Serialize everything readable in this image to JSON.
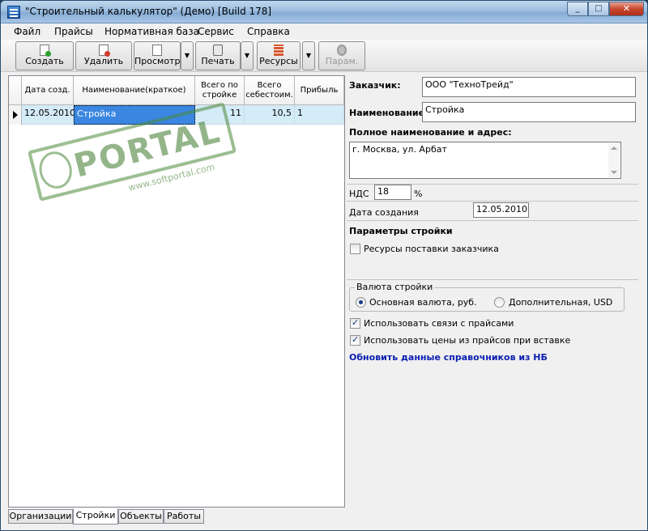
{
  "window": {
    "title": "\"Строительный калькулятор\" (Демо) [Build 178]",
    "minimize": "_",
    "maximize": "□",
    "close": "✕"
  },
  "menu": [
    "Файл",
    "Прайсы",
    "Нормативная база",
    "Сервис",
    "Справка"
  ],
  "toolbar": {
    "create": "Создать",
    "delete": "Удалить",
    "view": "Просмотр",
    "print": "Печать",
    "resources": "Ресурсы",
    "params": "Парам."
  },
  "grid": {
    "headers": [
      "Дата созд.",
      "Наименование(краткое)",
      "Всего по стройке",
      "Всего себестоим.",
      "Прибыль"
    ],
    "rows": [
      {
        "date": "12.05.2010",
        "name": "Стройка",
        "total": "11",
        "cost": "10,5",
        "profit": "1"
      }
    ]
  },
  "tabs": [
    "Организации",
    "Стройки",
    "Объекты",
    "Работы"
  ],
  "active_tab": "Стройки",
  "form": {
    "customer_label": "Заказчик:",
    "customer_value": "ООО \"ТехноТрейд\"",
    "name_label": "Наименование:",
    "name_value": "Стройка",
    "fullname_label": "Полное наименование и адрес:",
    "fullname_value": "г. Москва, ул. Арбат",
    "vat_label": "НДС",
    "vat_value": "18",
    "vat_unit": "%",
    "date_label": "Дата создания",
    "date_value": "12.05.2010",
    "params_title": "Параметры стройки",
    "customer_resources": "Ресурсы поставки заказчика",
    "currency_group": "Валюта стройки",
    "currency_main": "Основная валюта, руб.",
    "currency_extra": "Дополнительная, USD",
    "use_price_links": "Использовать связи с прайсами",
    "use_price_values": "Использовать цены из прайсов при вставке",
    "update_refs_link": "Обновить данные справочников из НБ"
  },
  "watermark": {
    "text": "PORTAL",
    "url": "www.softportal.com"
  }
}
